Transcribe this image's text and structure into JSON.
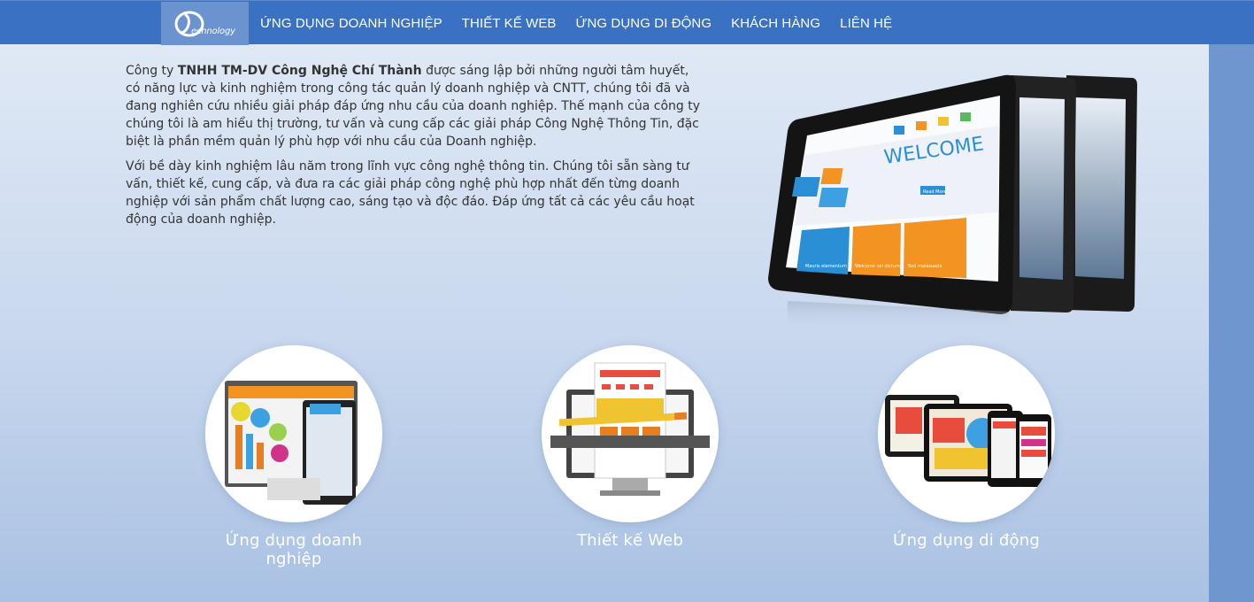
{
  "logo": {
    "text": "echnology"
  },
  "nav": {
    "items": [
      {
        "label": "ỨNG DỤNG DOANH NGHIỆP",
        "name": "nav-ung-dung-doanh-nghiep"
      },
      {
        "label": "THIẾT KẾ WEB",
        "name": "nav-thiet-ke-web"
      },
      {
        "label": "ỨNG DỤNG DI ĐỘNG",
        "name": "nav-ung-dung-di-dong"
      },
      {
        "label": "KHÁCH HÀNG",
        "name": "nav-khach-hang"
      },
      {
        "label": "LIÊN HỆ",
        "name": "nav-lien-he"
      }
    ]
  },
  "intro": {
    "p1_prefix": "Công ty ",
    "p1_company": "TNHH TM-DV Công Nghệ Chí Thành",
    "p1_rest": " được sáng lập bởi những người tâm huyết, có năng lực và kinh nghiệm trong công tác quản lý doanh nghiệp và CNTT, chúng tôi đã và đang nghiên cứu nhiều giải pháp đáp ứng nhu cầu của doanh nghiệp. Thế mạnh của công ty chúng tôi là am hiểu thị trường, tư vấn và cung cấp các giải pháp Công Nghệ Thông Tin, đặc biệt là phần mềm quản lý phù hợp với nhu cầu của Doanh nghiệp.",
    "p2": "Với bề dày kinh nghiệm lâu năm trong lĩnh vực công nghệ thông tin. Chúng tôi sẵn sàng tư vấn, thiết kế, cung cấp, và đưa ra các giải pháp công nghệ phù hợp nhất đến từng doanh nghiệp với sản phẩm chất lượng cao, sáng tạo và độc đáo. Đáp ứng tất cả các yêu cầu hoạt động của doanh nghiệp."
  },
  "hero": {
    "welcome": "WELCOME",
    "tile1": "Mauris elementum",
    "tile2": "Welcome vel dictum",
    "tile3": "Sed malesuada",
    "read_more": "Read More"
  },
  "services": [
    {
      "label": "Ứng dụng doanh nghiệp"
    },
    {
      "label": "Thiết kế Web"
    },
    {
      "label": "Ứng dụng di động"
    }
  ],
  "colors": {
    "nav_bg": "#3b71c2",
    "logo_bg": "#6b93cf",
    "accent_orange": "#f39322",
    "accent_blue": "#2b8fd6"
  }
}
